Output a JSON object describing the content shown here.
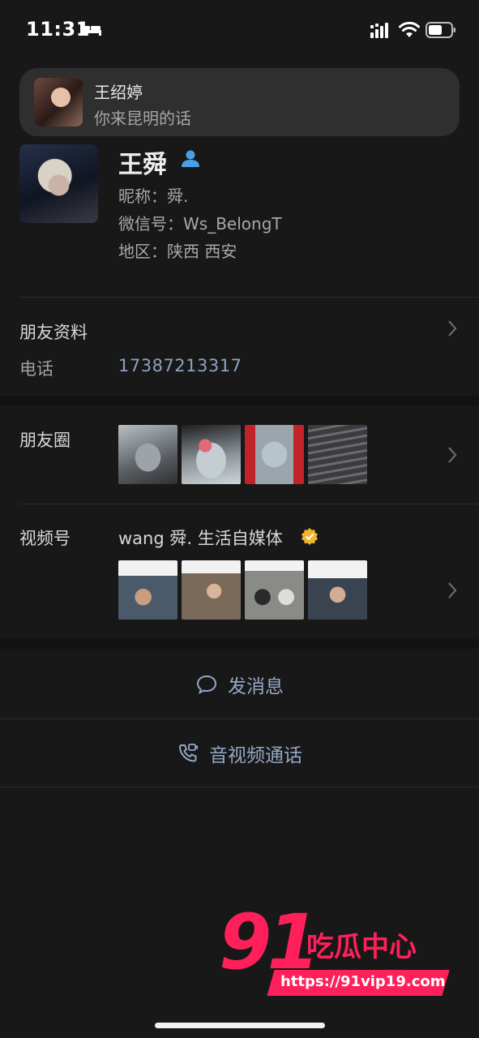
{
  "status_bar": {
    "time": "11:31"
  },
  "notification": {
    "sender": "王绍婷",
    "message": "你来昆明的话"
  },
  "profile": {
    "name": "王舜",
    "nickname": "昵称：舜.",
    "wechat_id": "微信号：Ws_BelongT",
    "region": "地区：陕西 西安"
  },
  "friend_info": {
    "label": "朋友资料",
    "phone_label": "电话",
    "phone_value": "17387213317"
  },
  "moments": {
    "label": "朋友圈"
  },
  "channels": {
    "label": "视频号",
    "name": "wang 舜.  生活自媒体"
  },
  "actions": {
    "message": "发消息",
    "call": "音视频通话"
  },
  "watermark": {
    "number": "91",
    "text": "吃瓜中心",
    "url": "https://91vip19.com"
  },
  "colors": {
    "background": "#181818",
    "link_blue": "#8ea1c2",
    "watermark_pink": "#ff1f5a"
  }
}
